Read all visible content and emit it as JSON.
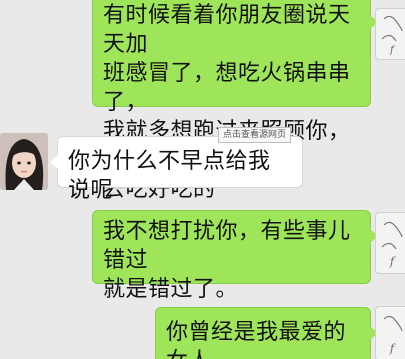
{
  "messages": [
    {
      "side": "right",
      "text": "有时候看着你朋友圈说天天加\n班感冒了，想吃火锅串串了，\n我就多想跑过来照顾你，带你\n去吃好吃的"
    },
    {
      "side": "left",
      "text": "你为什么不早点给我说呢"
    },
    {
      "side": "right",
      "text": "我不想打扰你，有些事儿错过\n就是错过了。"
    },
    {
      "side": "right",
      "text": "你曾经是我最爱的女人"
    }
  ],
  "overlay": {
    "view_source_label": "点击查看源网页"
  },
  "colors": {
    "sent_bubble": "#9fe55a",
    "received_bubble": "#ffffff",
    "background": "#e9e9e9"
  }
}
